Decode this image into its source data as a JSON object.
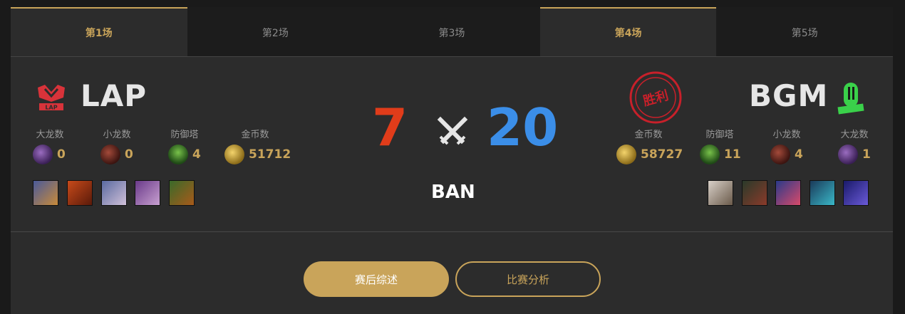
{
  "tabs": [
    {
      "label": "第1场",
      "active": true
    },
    {
      "label": "第2场",
      "active": false
    },
    {
      "label": "第3场",
      "active": false
    },
    {
      "label": "第4场",
      "active": true
    },
    {
      "label": "第5场",
      "active": false
    }
  ],
  "left_team": {
    "name": "LAP",
    "logo_text": "LAP",
    "stats": [
      {
        "label": "大龙数",
        "value": "0",
        "icon": "baron-icon"
      },
      {
        "label": "小龙数",
        "value": "0",
        "icon": "dragon-icon"
      },
      {
        "label": "防御塔",
        "value": "4",
        "icon": "tower-icon"
      },
      {
        "label": "金币数",
        "value": "51712",
        "icon": "gold-icon"
      }
    ],
    "champions": [
      "champion-1",
      "champion-2",
      "champion-3",
      "champion-4",
      "champion-5"
    ]
  },
  "right_team": {
    "name": "BGM",
    "stats": [
      {
        "label": "金币数",
        "value": "58727",
        "icon": "gold-icon"
      },
      {
        "label": "防御塔",
        "value": "11",
        "icon": "tower-icon"
      },
      {
        "label": "小龙数",
        "value": "4",
        "icon": "dragon-icon"
      },
      {
        "label": "大龙数",
        "value": "1",
        "icon": "baron-icon"
      }
    ],
    "champions": [
      "champion-1",
      "champion-2",
      "champion-3",
      "champion-4",
      "champion-5"
    ],
    "win_stamp": "胜利"
  },
  "score": {
    "left": "7",
    "right": "20"
  },
  "ban_label": "BAN",
  "buttons": {
    "summary": "赛后综述",
    "analysis": "比赛分析"
  },
  "colors": {
    "accent": "#c9a45a",
    "left_score": "#e03c1a",
    "right_score": "#3b8ee8",
    "stamp": "#c8202a"
  }
}
